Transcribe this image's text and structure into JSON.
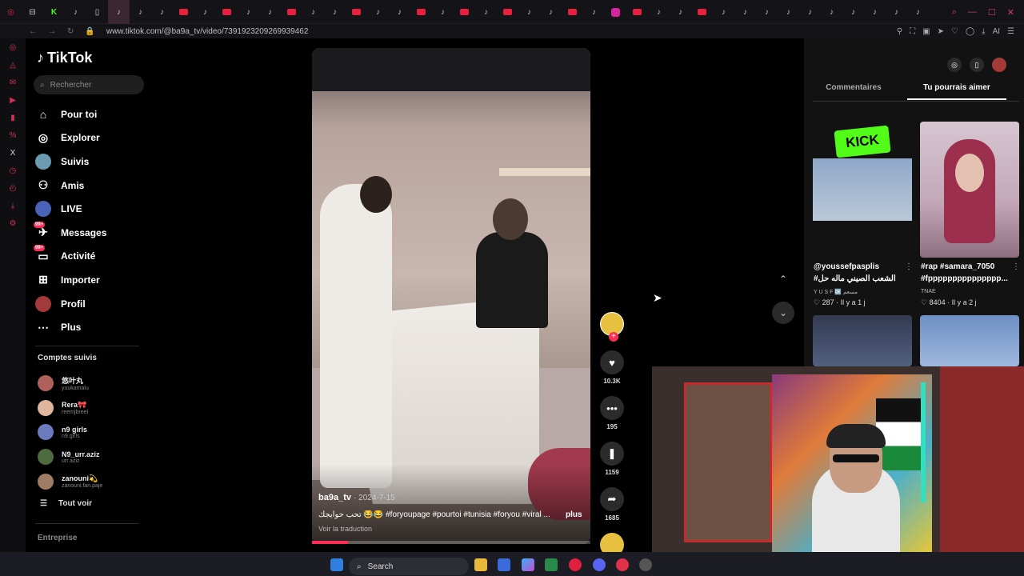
{
  "browser": {
    "url": "www.tiktok.com/@ba9a_tv/video/7391923209269939462",
    "tab_icons": [
      "opera-icon",
      "reddit-icon",
      "kick-icon",
      "tiktok-icon",
      "page-icon",
      "tiktok-active-icon",
      "tiktok-icon",
      "tiktok-icon",
      "tiktok-icon",
      "tiktok-icon",
      "tiktok-icon",
      "tiktok-icon",
      "tiktok-icon",
      "tiktok-icon",
      "tiktok-icon",
      "tiktok-icon",
      "tiktok-icon",
      "tiktok-icon",
      "tiktok-icon",
      "tiktok-icon",
      "tiktok-icon",
      "tiktok-icon",
      "tiktok-icon",
      "tiktok-icon",
      "tiktok-icon",
      "tiktok-icon",
      "tiktok-icon",
      "tiktok-icon",
      "tiktok-icon",
      "tiktok-icon",
      "tiktok-icon",
      "tiktok-icon",
      "tiktok-icon",
      "tiktok-icon",
      "tiktok-icon",
      "tiktok-icon",
      "tiktok-icon",
      "tiktok-icon",
      "tiktok-icon",
      "tiktok-icon",
      "tiktok-icon",
      "tiktok-icon",
      "tiktok-icon"
    ],
    "right_label": "AI"
  },
  "tiktok": {
    "logo": "TikTok",
    "search_placeholder": "Rechercher",
    "nav": [
      {
        "label": "Pour toi",
        "icon": "home-icon"
      },
      {
        "label": "Explorer",
        "icon": "compass-icon"
      },
      {
        "label": "Suivis",
        "icon": "following-avatar-icon"
      },
      {
        "label": "Amis",
        "icon": "friends-icon"
      },
      {
        "label": "LIVE",
        "icon": "live-icon"
      },
      {
        "label": "Messages",
        "icon": "messages-icon",
        "badge": "99+"
      },
      {
        "label": "Activité",
        "icon": "activity-icon",
        "badge": "99+"
      },
      {
        "label": "Importer",
        "icon": "upload-icon"
      },
      {
        "label": "Profil",
        "icon": "profile-avatar-icon"
      },
      {
        "label": "Plus",
        "icon": "more-icon"
      }
    ],
    "followed_title": "Comptes suivis",
    "followed": [
      {
        "name": "悠叶丸",
        "handle": "yuukamalu",
        "color": "#b0605a"
      },
      {
        "name": "Rera🎀",
        "handle": "reemjbreel",
        "color": "#e0b59e"
      },
      {
        "name": "n9 girls",
        "handle": "n9.girls",
        "color": "#6a7bbf"
      },
      {
        "name": "N9_urr.aziz",
        "handle": "urr.aziz",
        "color": "#4e6a3f"
      },
      {
        "name": "zanouni💫",
        "handle": "zanouni.fan.paje",
        "color": "#a07b66"
      }
    ],
    "see_all": "Tout voir",
    "entreprise": "Entreprise"
  },
  "video": {
    "author": "ba9a_tv",
    "date": "· 2024-7-15",
    "caption": "تحب حوايجك 😂😂 #foryoupage #pourtoi #tunisia #foryou #viral ...",
    "more": "plus",
    "translate": "Voir la traduction",
    "progress": 0.13,
    "likes": "10.3K",
    "comments": "195",
    "saves": "1159",
    "shares": "1685"
  },
  "right": {
    "tabs": [
      "Commentaires",
      "Tu pourrais aimer"
    ],
    "active_tab": 1,
    "cards": [
      {
        "user": "@youssefpasplis",
        "desc": "الشعب الصيني ماله حل#",
        "sub": "Y U S F 🆗 مسعم",
        "likes": "287",
        "age": "· Il y a 1 j"
      },
      {
        "user": "#rap #samara_7050",
        "desc": "#fppppppppppppppp...",
        "sub": "TNAE",
        "likes": "8404",
        "age": "· Il y a 2 j"
      }
    ]
  },
  "taskbar": {
    "search": "Search"
  }
}
